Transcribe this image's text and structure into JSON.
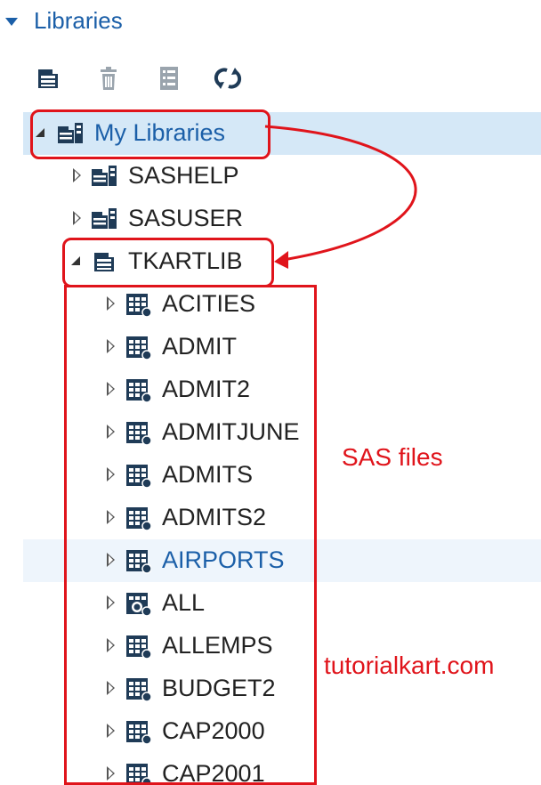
{
  "header": {
    "title": "Libraries"
  },
  "toolbar": {
    "icons": [
      "new-library-icon",
      "delete-icon",
      "properties-icon",
      "refresh-icon"
    ]
  },
  "tree": {
    "root": {
      "label": "My Libraries"
    },
    "libraries": [
      {
        "label": "SASHELP"
      },
      {
        "label": "SASUSER"
      },
      {
        "label": "TKARTLIB"
      }
    ],
    "tables": [
      {
        "label": "ACITIES"
      },
      {
        "label": "ADMIT"
      },
      {
        "label": "ADMIT2"
      },
      {
        "label": "ADMITJUNE"
      },
      {
        "label": "ADMITS"
      },
      {
        "label": "ADMITS2"
      },
      {
        "label": "AIRPORTS"
      },
      {
        "label": "ALL"
      },
      {
        "label": "ALLEMPS"
      },
      {
        "label": "BUDGET2"
      },
      {
        "label": "CAP2000"
      },
      {
        "label": "CAP2001"
      }
    ]
  },
  "annotations": {
    "sas_files": "SAS files",
    "watermark": "tutorialkart.com"
  },
  "colors": {
    "accent": "#1b5fa8",
    "annotation": "#e0141b",
    "selected_row": "#d5e8f7",
    "hover_row": "#eef5fc"
  }
}
